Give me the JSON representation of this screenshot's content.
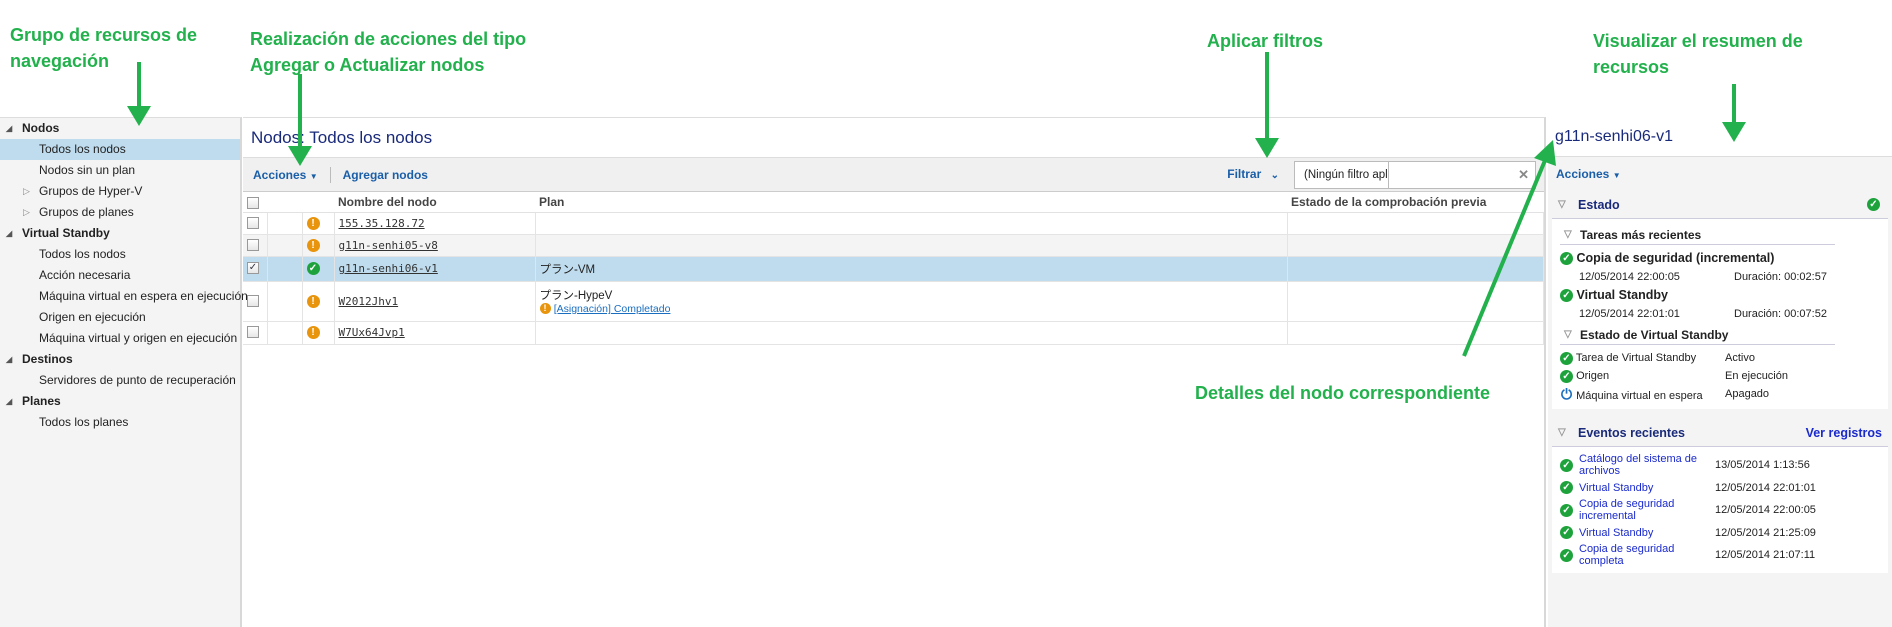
{
  "annotations": {
    "nav_group": [
      "Grupo de recursos de",
      "navegación"
    ],
    "actions": [
      "Realización de acciones del tipo",
      "Agregar o Actualizar nodos"
    ],
    "filters": "Aplicar filtros",
    "summary": [
      "Visualizar el resumen de",
      "recursos"
    ],
    "details": "Detalles del nodo correspondiente"
  },
  "sidebar": {
    "groups": [
      {
        "label": "Nodos",
        "items": [
          {
            "label": "Todos los nodos",
            "selected": true
          },
          {
            "label": "Nodos sin un plan"
          },
          {
            "label": "Grupos de Hyper-V",
            "expandable": true
          },
          {
            "label": "Grupos de planes",
            "expandable": true
          }
        ]
      },
      {
        "label": "Virtual Standby",
        "items": [
          {
            "label": "Todos los nodos"
          },
          {
            "label": "Acción necesaria"
          },
          {
            "label": "Máquina virtual en espera en ejecución"
          },
          {
            "label": "Origen en ejecución"
          },
          {
            "label": "Máquina virtual y origen en ejecución"
          }
        ]
      },
      {
        "label": "Destinos",
        "items": [
          {
            "label": "Servidores de punto de recuperación"
          }
        ]
      },
      {
        "label": "Planes",
        "items": [
          {
            "label": "Todos los planes"
          }
        ]
      }
    ]
  },
  "main": {
    "title": "Nodos: Todos los nodos",
    "toolbar": {
      "actions": "Acciones",
      "add_nodes": "Agregar nodos",
      "filter": "Filtrar",
      "filter_value": "(Ningún filtro aplicado)",
      "search_value": ""
    },
    "columns": [
      "Nombre del nodo",
      "Plan",
      "Estado de la comprobación previa"
    ],
    "rows": [
      {
        "name": "155.35.128.72",
        "status": "warning",
        "plan": "",
        "checked": false
      },
      {
        "name": "g11n-senhi05-v8",
        "status": "warning",
        "plan": "",
        "checked": false
      },
      {
        "name": "g11n-senhi06-v1",
        "status": "ok",
        "plan": "プラン-VM",
        "checked": true
      },
      {
        "name": "W2012Jhv1",
        "status": "warning",
        "plan": "プラン-HypeV",
        "plan_note": "[Asignación] Completado",
        "checked": false
      },
      {
        "name": "W7Ux64Jvp1",
        "status": "warning",
        "plan": "",
        "checked": false
      }
    ]
  },
  "right": {
    "title": "g11n-senhi06-v1",
    "actions": "Acciones",
    "estado": "Estado",
    "recent_tasks": "Tareas más recientes",
    "tasks": [
      {
        "name": "Copia de seguridad (incremental)",
        "time": "12/05/2014 22:00:05",
        "duration": "Duración: 00:02:57"
      },
      {
        "name": "Virtual Standby",
        "time": "12/05/2014 22:01:01",
        "duration": "Duración: 00:07:52"
      }
    ],
    "vs_state": "Estado de Virtual Standby",
    "vs_items": [
      {
        "key": "Tarea de Virtual Standby",
        "value": "Activo",
        "icon": "ok"
      },
      {
        "key": "Origen",
        "value": "En ejecución",
        "icon": "ok"
      },
      {
        "key": "Máquina virtual en espera",
        "value": "Apagado",
        "icon": "power"
      }
    ],
    "events_title": "Eventos recientes",
    "view_logs": "Ver registros",
    "events": [
      {
        "name": "Catálogo del sistema de archivos",
        "time": "13/05/2014 1:13:56"
      },
      {
        "name": "Virtual Standby",
        "time": "12/05/2014 22:01:01"
      },
      {
        "name": "Copia de seguridad incremental",
        "time": "12/05/2014 22:00:05"
      },
      {
        "name": "Virtual Standby",
        "time": "12/05/2014 21:25:09"
      },
      {
        "name": "Copia de seguridad completa",
        "time": "12/05/2014 21:07:11"
      }
    ]
  },
  "colors": {
    "annotation": "#22b14c",
    "selection": "#bedcee",
    "link": "#1a5ea8"
  }
}
